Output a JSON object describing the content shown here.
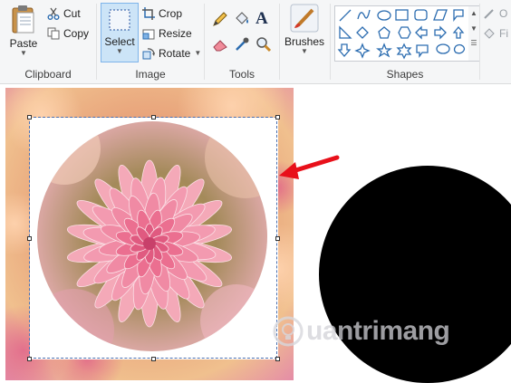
{
  "clipboard": {
    "paste_label": "Paste",
    "cut_label": "Cut",
    "copy_label": "Copy",
    "group_label": "Clipboard"
  },
  "image": {
    "select_label": "Select",
    "crop_label": "Crop",
    "resize_label": "Resize",
    "rotate_label": "Rotate",
    "group_label": "Image"
  },
  "tools": {
    "group_label": "Tools",
    "items": [
      "pencil-icon",
      "fill-bucket-icon",
      "text-icon",
      "eraser-icon",
      "color-picker-icon",
      "magnifier-icon"
    ]
  },
  "brushes": {
    "label": "Brushes"
  },
  "shapes": {
    "group_label": "Shapes",
    "outline_label": "O",
    "fill_label": "Fi"
  },
  "watermark": {
    "text": "uantrimang"
  },
  "colors": {
    "accent": "#2b579a",
    "select_highlight": "#cce4f7",
    "arrow": "#e8101a"
  }
}
